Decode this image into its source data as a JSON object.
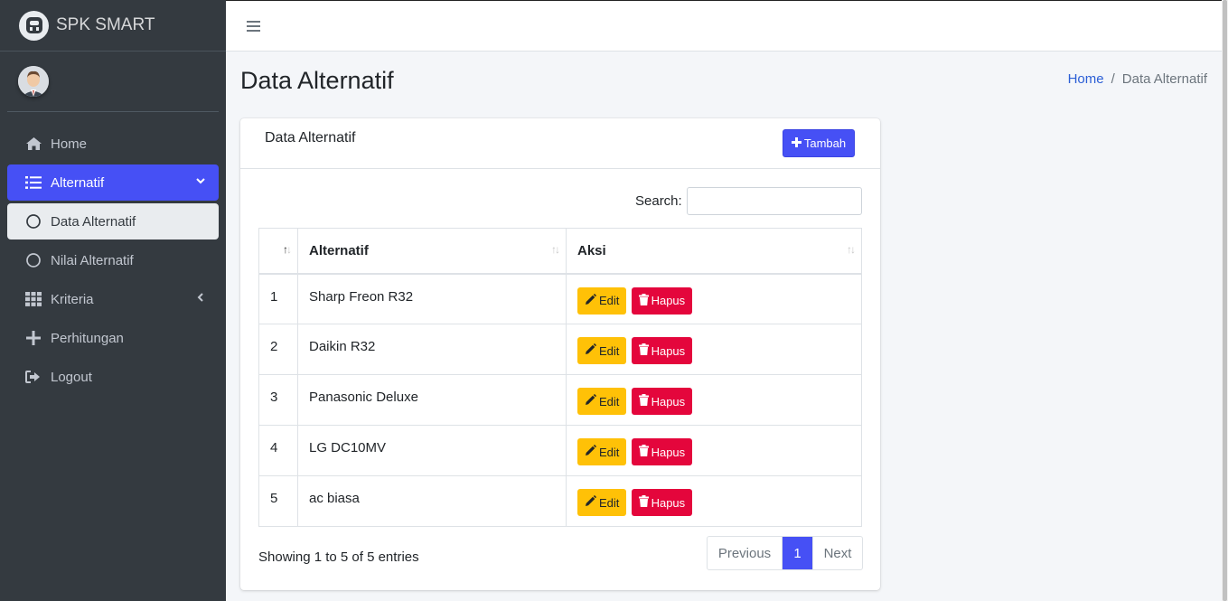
{
  "app": {
    "brand": "SPK SMART"
  },
  "sidebar": {
    "items": [
      {
        "label": "Home",
        "icon": "home-icon"
      },
      {
        "label": "Alternatif",
        "icon": "list-icon"
      },
      {
        "label": "Data Alternatif",
        "icon": "circle-icon"
      },
      {
        "label": "Nilai Alternatif",
        "icon": "circle-icon"
      },
      {
        "label": "Kriteria",
        "icon": "grid-icon"
      },
      {
        "label": "Perhitungan",
        "icon": "plus-icon"
      },
      {
        "label": "Logout",
        "icon": "sign-out-icon"
      }
    ]
  },
  "page": {
    "title": "Data Alternatif",
    "breadcrumb": {
      "home": "Home",
      "separator": "/",
      "current": "Data Alternatif"
    }
  },
  "card": {
    "title": "Data Alternatif",
    "add_label": "Tambah",
    "search_label": "Search:",
    "search_value": "",
    "columns": [
      "",
      "Alternatif",
      "Aksi"
    ],
    "rows": [
      {
        "no": "1",
        "name": "Sharp Freon R32"
      },
      {
        "no": "2",
        "name": "Daikin R32"
      },
      {
        "no": "3",
        "name": "Panasonic Deluxe"
      },
      {
        "no": "4",
        "name": "LG DC10MV"
      },
      {
        "no": "5",
        "name": "ac biasa"
      }
    ],
    "edit_label": "Edit",
    "delete_label": "Hapus",
    "info": "Showing 1 to 5 of 5 entries",
    "pagination": {
      "previous": "Previous",
      "current": "1",
      "next": "Next"
    }
  },
  "colors": {
    "primary": "#4650f5",
    "warning": "#ffc107",
    "danger": "#e4063c",
    "sidebar": "#343a40"
  }
}
